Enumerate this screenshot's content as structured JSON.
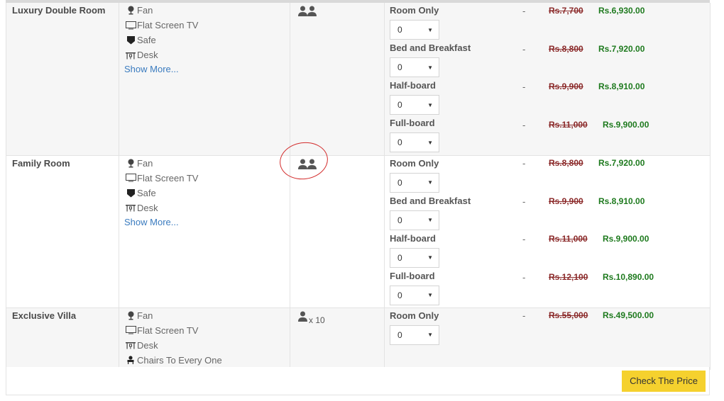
{
  "rooms": [
    {
      "name": "Luxury Double Room",
      "amenities": [
        {
          "icon": "fan-icon",
          "label": "Fan"
        },
        {
          "icon": "tv-icon",
          "label": "Flat Screen TV"
        },
        {
          "icon": "safe-icon",
          "label": "Safe"
        },
        {
          "icon": "desk-icon",
          "label": "Desk"
        }
      ],
      "show_more": "Show More...",
      "occupancy": {
        "icon": "two-persons-icon",
        "multiplier": ""
      },
      "plans": [
        {
          "label": "Room Only",
          "qty": "0",
          "dash": "-",
          "old_price": "Rs.7,700",
          "new_price": "Rs.6,930.00"
        },
        {
          "label": "Bed and Breakfast",
          "qty": "0",
          "dash": "-",
          "old_price": "Rs.8,800",
          "new_price": "Rs.7,920.00"
        },
        {
          "label": "Half-board",
          "qty": "0",
          "dash": "-",
          "old_price": "Rs.9,900",
          "new_price": "Rs.8,910.00"
        },
        {
          "label": "Full-board",
          "qty": "0",
          "dash": "-",
          "old_price": "Rs.11,000",
          "new_price": "Rs.9,900.00"
        }
      ]
    },
    {
      "name": "Family Room",
      "amenities": [
        {
          "icon": "fan-icon",
          "label": "Fan"
        },
        {
          "icon": "tv-icon",
          "label": "Flat Screen TV"
        },
        {
          "icon": "safe-icon",
          "label": "Safe"
        },
        {
          "icon": "desk-icon",
          "label": "Desk"
        }
      ],
      "show_more": "Show More...",
      "occupancy": {
        "icon": "two-persons-icon",
        "multiplier": ""
      },
      "plans": [
        {
          "label": "Room Only",
          "qty": "0",
          "dash": "-",
          "old_price": "Rs.8,800",
          "new_price": "Rs.7,920.00"
        },
        {
          "label": "Bed and Breakfast",
          "qty": "0",
          "dash": "-",
          "old_price": "Rs.9,900",
          "new_price": "Rs.8,910.00"
        },
        {
          "label": "Half-board",
          "qty": "0",
          "dash": "-",
          "old_price": "Rs.11,000",
          "new_price": "Rs.9,900.00"
        },
        {
          "label": "Full-board",
          "qty": "0",
          "dash": "-",
          "old_price": "Rs.12,100",
          "new_price": "Rs.10,890.00"
        }
      ]
    },
    {
      "name": "Exclusive Villa",
      "amenities": [
        {
          "icon": "fan-icon",
          "label": "Fan"
        },
        {
          "icon": "tv-icon",
          "label": "Flat Screen TV"
        },
        {
          "icon": "desk-icon",
          "label": "Desk"
        },
        {
          "icon": "chair-icon",
          "label": "Chairs To Every One"
        }
      ],
      "show_more": "",
      "occupancy": {
        "icon": "person-icon",
        "multiplier": "x 10"
      },
      "plans": [
        {
          "label": "Room Only",
          "qty": "0",
          "dash": "-",
          "old_price": "Rs.55,000",
          "new_price": "Rs.49,500.00"
        }
      ]
    }
  ],
  "footer": {
    "check_price_label": "Check The Price"
  },
  "colors": {
    "accent_button": "#f5d12e",
    "new_price": "#1e7a1e",
    "old_price": "#8b2a2a",
    "link": "#3a7bbf",
    "annotation_circle": "#d32c2c"
  }
}
